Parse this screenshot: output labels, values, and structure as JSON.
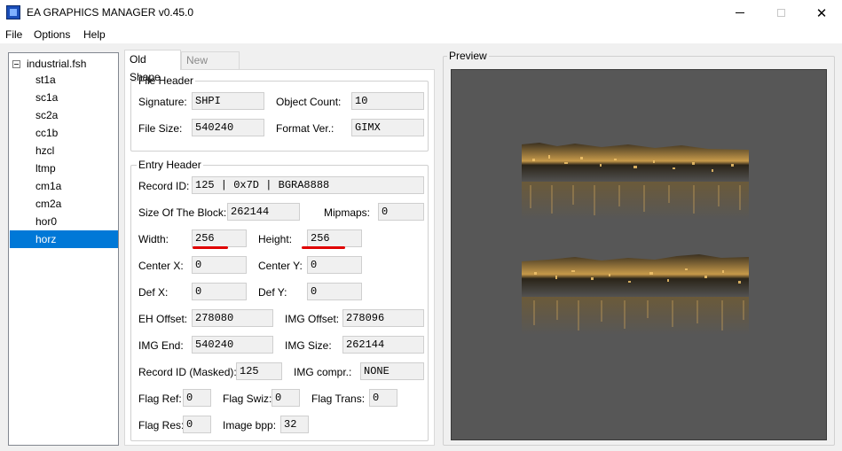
{
  "window": {
    "title": "EA GRAPHICS MANAGER v0.45.0",
    "minimize_glyph": "",
    "maximize_glyph": "",
    "close_glyph": "✕"
  },
  "menu": [
    "File",
    "Options",
    "Help"
  ],
  "tree": {
    "root": "industrial.fsh",
    "items": [
      "st1a",
      "sc1a",
      "sc2a",
      "cc1b",
      "hzcl",
      "ltmp",
      "cm1a",
      "cm2a",
      "hor0",
      "horz"
    ],
    "selected": "horz"
  },
  "tabs": [
    "Old Shape",
    "New Shape"
  ],
  "file_header": {
    "title": "File Header",
    "signature_label": "Signature:",
    "signature": "SHPI",
    "object_count_label": "Object Count:",
    "object_count": "10",
    "file_size_label": "File Size:",
    "file_size": "540240",
    "format_ver_label": "Format Ver.:",
    "format_ver": "GIMX"
  },
  "entry_header": {
    "title": "Entry Header",
    "record_id_label": "Record ID:",
    "record_id": "125 | 0x7D | BGRA8888",
    "block_size_label": "Size Of The Block:",
    "block_size": "262144",
    "mipmaps_label": "Mipmaps:",
    "mipmaps": "0",
    "width_label": "Width:",
    "width": "256",
    "height_label": "Height:",
    "height": "256",
    "center_x_label": "Center X:",
    "center_x": "0",
    "center_y_label": "Center Y:",
    "center_y": "0",
    "def_x_label": "Def X:",
    "def_x": "0",
    "def_y_label": "Def Y:",
    "def_y": "0",
    "eh_offset_label": "EH Offset:",
    "eh_offset": "278080",
    "img_offset_label": "IMG Offset:",
    "img_offset": "278096",
    "img_end_label": "IMG End:",
    "img_end": "540240",
    "img_size_label": "IMG Size:",
    "img_size": "262144",
    "record_id_masked_label": "Record ID (Masked):",
    "record_id_masked": "125",
    "img_compr_label": "IMG compr.:",
    "img_compr": "NONE",
    "flag_ref_label": "Flag Ref:",
    "flag_ref": "0",
    "flag_swiz_label": "Flag Swiz:",
    "flag_swiz": "0",
    "flag_trans_label": "Flag Trans:",
    "flag_trans": "0",
    "flag_res_label": "Flag Res:",
    "flag_res": "0",
    "image_bpp_label": "Image bpp:",
    "image_bpp": "32"
  },
  "preview": {
    "title": "Preview",
    "background_color": "#575757"
  },
  "colors": {
    "selection": "#0078d7",
    "annotation_underline": "#e00000"
  }
}
